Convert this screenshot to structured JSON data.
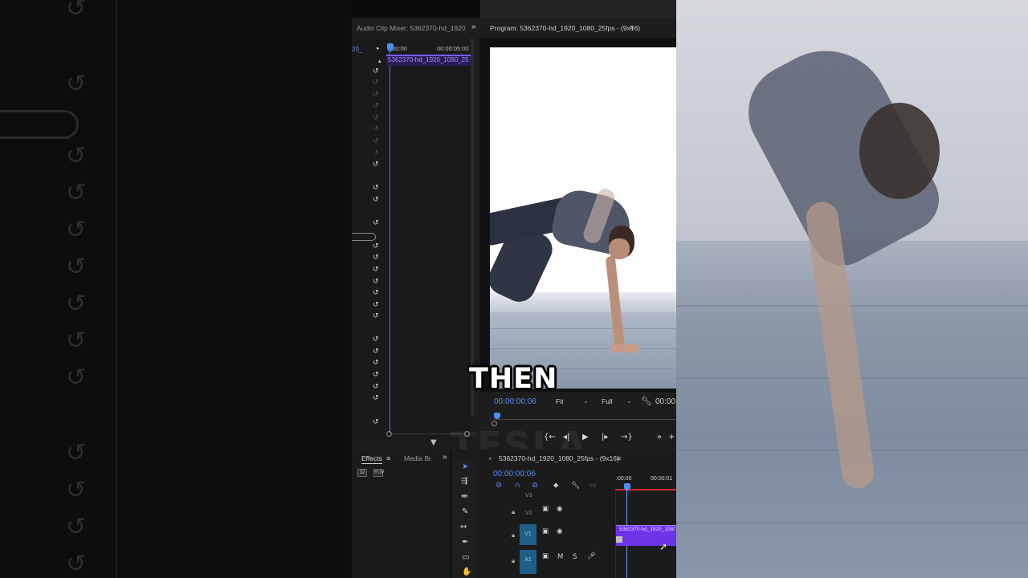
{
  "caption": {
    "text": "THEN"
  },
  "left_panel": {
    "ghost_undo_icon": "undo-icon"
  },
  "audio_mixer": {
    "tab_label": "Audio Clip Mixer: 5362370-hd_1920",
    "expand_glyph": "»",
    "sequence_label": "20_",
    "ruler_start": ":00:00",
    "ruler_end": "00:00:05:00",
    "clip_label": "5362370-hd_1920_1080_25",
    "undo_glyph": "↺"
  },
  "program_monitor": {
    "tab_label": "Program: 5362370-hd_1920_1080_25fps - (9x16)",
    "menu_glyph": "≡",
    "timecode": "00:00:00:06",
    "fit_label": "Fit",
    "full_label": "Full",
    "duration": "00:00",
    "transport": {
      "mark_in": "{←",
      "step_back": "◂|",
      "play": "▶",
      "step_forward": "|▸",
      "mark_out": "→}",
      "more": "»",
      "add": "+"
    }
  },
  "effects_panel": {
    "effects_tab": "Effects",
    "menu_glyph": "≡",
    "media_tab": "Media Br",
    "expand_glyph": "»",
    "btn1_label": "32",
    "btn2_label": "YUV"
  },
  "timeline": {
    "close_glyph": "×",
    "tab_label": "5362370-hd_1920_1080_25fps - (9x16)",
    "menu_glyph": "≡",
    "timecode": "00:00:00:06",
    "ruler_start": ":00:00",
    "ruler_end": "00:00:01",
    "tracks": [
      {
        "name": "V3",
        "label": "V3"
      },
      {
        "name": "V2",
        "label": "V2"
      },
      {
        "name": "V1",
        "label": "V1"
      },
      {
        "name": "A1",
        "label": "A1"
      }
    ],
    "audio_mute": "M",
    "audio_solo": "S",
    "clip_label": "5362370-hd_1920_1080_2"
  },
  "watermark": {
    "text": "TESLA CREATE"
  },
  "colors": {
    "accent_blue": "#4f8ef0",
    "clip_purple": "#6d33e8",
    "mixer_clip_purple": "#a58cff",
    "playhead_red": "#d03030"
  }
}
